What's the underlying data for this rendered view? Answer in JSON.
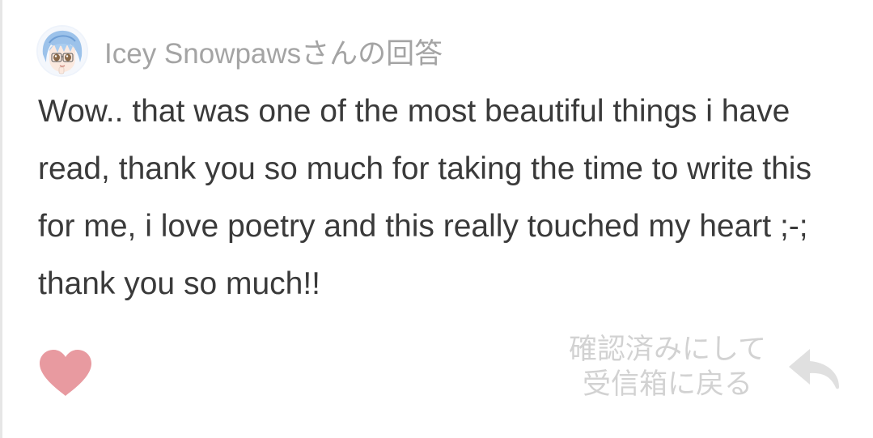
{
  "answer": {
    "author_line": "Icey Snowpawsさんの回答",
    "text": "Wow.. that was one of the most beautiful things i have read, thank you so much for taking the time to write this for me, i love poetry and this really touched my heart ;-; thank you so much!!"
  },
  "actions": {
    "mark_read_line1": "確認済みにして",
    "mark_read_line2": "受信箱に戻る"
  },
  "icons": {
    "avatar": "anime-avatar",
    "like": "heart-icon",
    "return": "reply-arrow-icon"
  },
  "colors": {
    "heart": "#e89aa0",
    "reply_arrow": "#e0e0e0",
    "author_text": "#a4a4a4",
    "body_text": "#3a3a3a",
    "action_text": "#d2d2d2"
  }
}
